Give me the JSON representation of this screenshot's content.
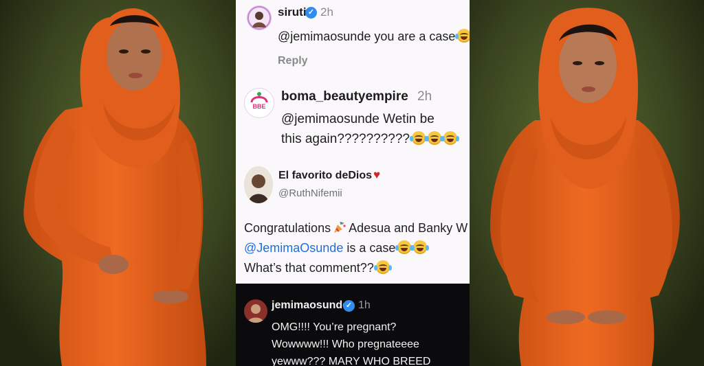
{
  "colors": {
    "background_green": "#2a3318",
    "dress_orange": "#e8621f",
    "verified_blue": "#2f8cf0",
    "link_blue": "#1d6fe0",
    "heart_red": "#d8232a"
  },
  "comments": [
    {
      "username": "siruti",
      "time": "2h",
      "verified": true,
      "text": "@jemimaosunde you are a case",
      "reply_label": "Reply"
    },
    {
      "username": "boma_beautyempire",
      "time": "2h",
      "verified": false,
      "line1": "@jemimaosunde Wetin be",
      "line2": "this again??????????"
    }
  ],
  "tweet": {
    "display_name": "El favorito deDios",
    "handle": "@RuthNifemii",
    "line1": "Congratulations",
    "line1_rest": "Adesua and Banky W",
    "mention": "@JemimaOsunde",
    "line2_rest": "is a case",
    "line3": "What’s that comment??"
  },
  "dark_comment": {
    "username": "jemimaosunde",
    "time": "1h",
    "verified": true,
    "line1": "OMG!!!! You’re pregnant?",
    "line2": "Wowwww!!! Who pregnateeee",
    "line3": "yewww??? MARY WHO BREED"
  },
  "icons": [
    "verified-badge-icon",
    "tears-of-joy-emoji-icon",
    "party-popper-icon",
    "red-heart-icon"
  ]
}
